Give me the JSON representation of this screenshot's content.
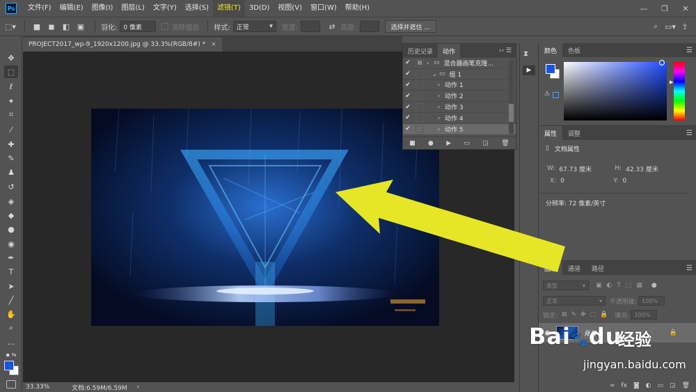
{
  "app": {
    "logo": "Ps"
  },
  "menu": [
    "文件(F)",
    "编辑(E)",
    "图像(I)",
    "图层(L)",
    "文字(Y)",
    "选择(S)",
    "滤镜(T)",
    "3D(D)",
    "视图(V)",
    "窗口(W)",
    "帮助(H)"
  ],
  "menu_active_index": 6,
  "window_controls": {
    "minimize": "—",
    "restore": "❐",
    "close": "✕"
  },
  "options": {
    "feather_label": "羽化:",
    "feather_value": "0 像素",
    "antialias_label": "消除锯齿",
    "style_label": "样式:",
    "style_value": "正常",
    "width_label": "宽度:",
    "height_label": "高度:",
    "select_mask_button": "选择并遮住 ..."
  },
  "document": {
    "tab_title": "PROJECT2017_wp-9_1920x1200.jpg @ 33.3%(RGB/8#) *",
    "tab_close": "×",
    "zoom": "33.33%",
    "doc_info": "文档:6.59M/6.59M",
    "status_arrow": "›"
  },
  "actions_panel": {
    "tabs": [
      "历史记录",
      "动作"
    ],
    "active_tab": 1,
    "rows": [
      {
        "label": "混合器画笔克隆...",
        "checked": true,
        "type": "set",
        "level": 0,
        "selected": false
      },
      {
        "label": "组 1",
        "checked": true,
        "type": "folder",
        "level": 1,
        "selected": false
      },
      {
        "label": "动作 1",
        "checked": true,
        "type": "action",
        "level": 2,
        "selected": false
      },
      {
        "label": "动作 2",
        "checked": true,
        "type": "action",
        "level": 2,
        "selected": false
      },
      {
        "label": "动作 3",
        "checked": true,
        "type": "action",
        "level": 2,
        "selected": false
      },
      {
        "label": "动作 4",
        "checked": true,
        "type": "action",
        "level": 2,
        "selected": false
      },
      {
        "label": "动作 5",
        "checked": true,
        "type": "action",
        "level": 2,
        "selected": true
      }
    ]
  },
  "color_panel": {
    "tabs": [
      "颜色",
      "色板"
    ],
    "foreground": "#1a52e6",
    "background": "#ffffff"
  },
  "properties_panel": {
    "tabs": [
      "属性",
      "调整"
    ],
    "title": "文档属性",
    "w_label": "W:",
    "w_value": "67.73 厘米",
    "h_label": "H:",
    "h_value": "42.33 厘米",
    "x_label": "X:",
    "x_value": "0",
    "y_label": "Y:",
    "y_value": "0",
    "resolution": "分辨率: 72 像素/英寸"
  },
  "layers_panel": {
    "tabs": [
      "图层",
      "通道",
      "路径"
    ],
    "filter_label": "类型",
    "blend_mode": "正常",
    "opacity_label": "不透明度:",
    "opacity_value": "100%",
    "lock_label": "锁定:",
    "fill_label": "填充:",
    "fill_value": "100%",
    "layer_name": "背景"
  },
  "watermark": {
    "brand": "Bai",
    "brand_suffix": "du",
    "cn": "经验",
    "url": "jingyan.baidu.com"
  },
  "colors": {
    "arrow": "#e6e626",
    "accent_menu": "#f3e32a"
  }
}
